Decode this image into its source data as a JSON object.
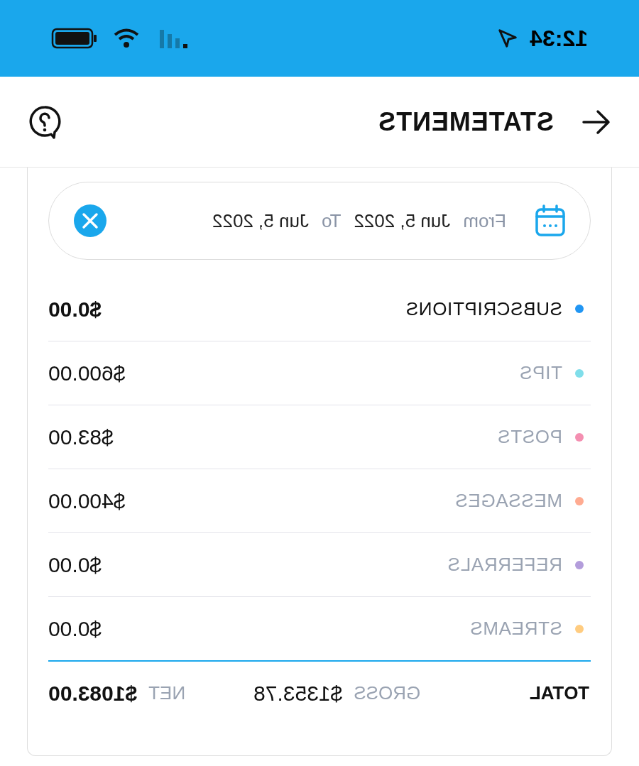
{
  "status_bar": {
    "time": "12:34"
  },
  "header": {
    "title": "STATEMENTS"
  },
  "date_filter": {
    "from_label": "From",
    "from_date": "Jun 5, 2022",
    "to_label": "To",
    "to_date": "Jun 5, 2022"
  },
  "categories": [
    {
      "label": "SUBSCRIPTIONS",
      "amount": "$0.00",
      "color": "#2196f3",
      "selected": true
    },
    {
      "label": "TIPS",
      "amount": "$600.00",
      "color": "#80deea",
      "selected": false
    },
    {
      "label": "POSTS",
      "amount": "$83.00",
      "color": "#f48fb1",
      "selected": false
    },
    {
      "label": "MESSAGES",
      "amount": "$400.00",
      "color": "#ffab91",
      "selected": false
    },
    {
      "label": "REFERRALS",
      "amount": "$0.00",
      "color": "#b39ddb",
      "selected": false
    },
    {
      "label": "STREAMS",
      "amount": "$0.00",
      "color": "#ffcc80",
      "selected": false
    }
  ],
  "total": {
    "label": "TOTAL",
    "gross_label": "GROSS",
    "gross": "$1353.78",
    "net_label": "NET",
    "net": "$1083.00"
  }
}
